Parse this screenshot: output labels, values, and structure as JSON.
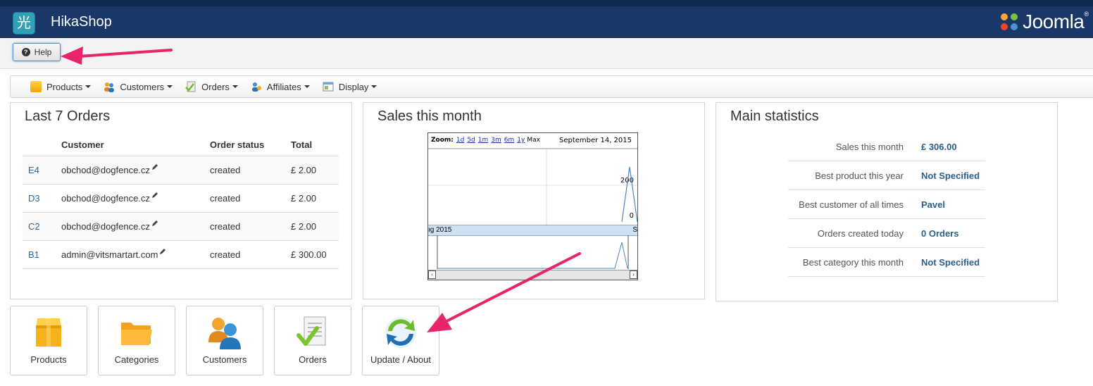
{
  "header": {
    "app_title": "HikaShop",
    "logo_glyph": "光",
    "brand": "Joomla!",
    "brand_text": "Joomla",
    "brand_reg": "®",
    "bg_color": "#1a3867"
  },
  "toolbar": {
    "help_label": "Help",
    "help_icon": "question-circle-icon"
  },
  "menu": [
    {
      "label": "Products",
      "icon": "box-icon"
    },
    {
      "label": "Customers",
      "icon": "users-icon"
    },
    {
      "label": "Orders",
      "icon": "orders-icon"
    },
    {
      "label": "Affiliates",
      "icon": "affiliates-icon"
    },
    {
      "label": "Display",
      "icon": "display-icon"
    }
  ],
  "last_orders": {
    "title": "Last 7 Orders",
    "columns": [
      "Customer",
      "Order status",
      "Total"
    ],
    "rows": [
      {
        "id": "E4",
        "customer": "obchod@dogfence.cz",
        "status": "created",
        "total": "£ 2.00"
      },
      {
        "id": "D3",
        "customer": "obchod@dogfence.cz",
        "status": "created",
        "total": "£ 2.00"
      },
      {
        "id": "C2",
        "customer": "obchod@dogfence.cz",
        "status": "created",
        "total": "£ 2.00"
      },
      {
        "id": "B1",
        "customer": "admin@vitsmartart.com",
        "status": "created",
        "total": "£ 300.00"
      }
    ]
  },
  "sales_month": {
    "title": "Sales this month",
    "zoom_label": "Zoom:",
    "zoom_options": [
      "1d",
      "5d",
      "1m",
      "3m",
      "6m",
      "1y"
    ],
    "zoom_max": "Max",
    "date": "September 14, 2015",
    "range_left": "ıg 2015",
    "range_right": "S"
  },
  "chart_data": {
    "type": "line",
    "x": [
      "Aug 2015",
      "Sep 14, 2015"
    ],
    "y_ticks": [
      0,
      200
    ],
    "series": [
      {
        "values": [
          0,
          0
        ]
      }
    ],
    "note_peak": 300
  },
  "main_stats": {
    "title": "Main statistics",
    "rows": [
      {
        "label": "Sales this month",
        "value": "£ 306.00"
      },
      {
        "label": "Best product this year",
        "value": "Not Specified"
      },
      {
        "label": "Best customer of all times",
        "value": "Pavel"
      },
      {
        "label": "Orders created today",
        "value": "0 Orders"
      },
      {
        "label": "Best category this month",
        "value": "Not Specified"
      }
    ]
  },
  "tiles": [
    {
      "label": "Products",
      "icon": "box-icon"
    },
    {
      "label": "Categories",
      "icon": "folder-icon"
    },
    {
      "label": "Customers",
      "icon": "users-icon"
    },
    {
      "label": "Orders",
      "icon": "orders-icon"
    },
    {
      "label": "Update / About",
      "icon": "update-icon"
    }
  ],
  "annotation_color": "#e8246a"
}
